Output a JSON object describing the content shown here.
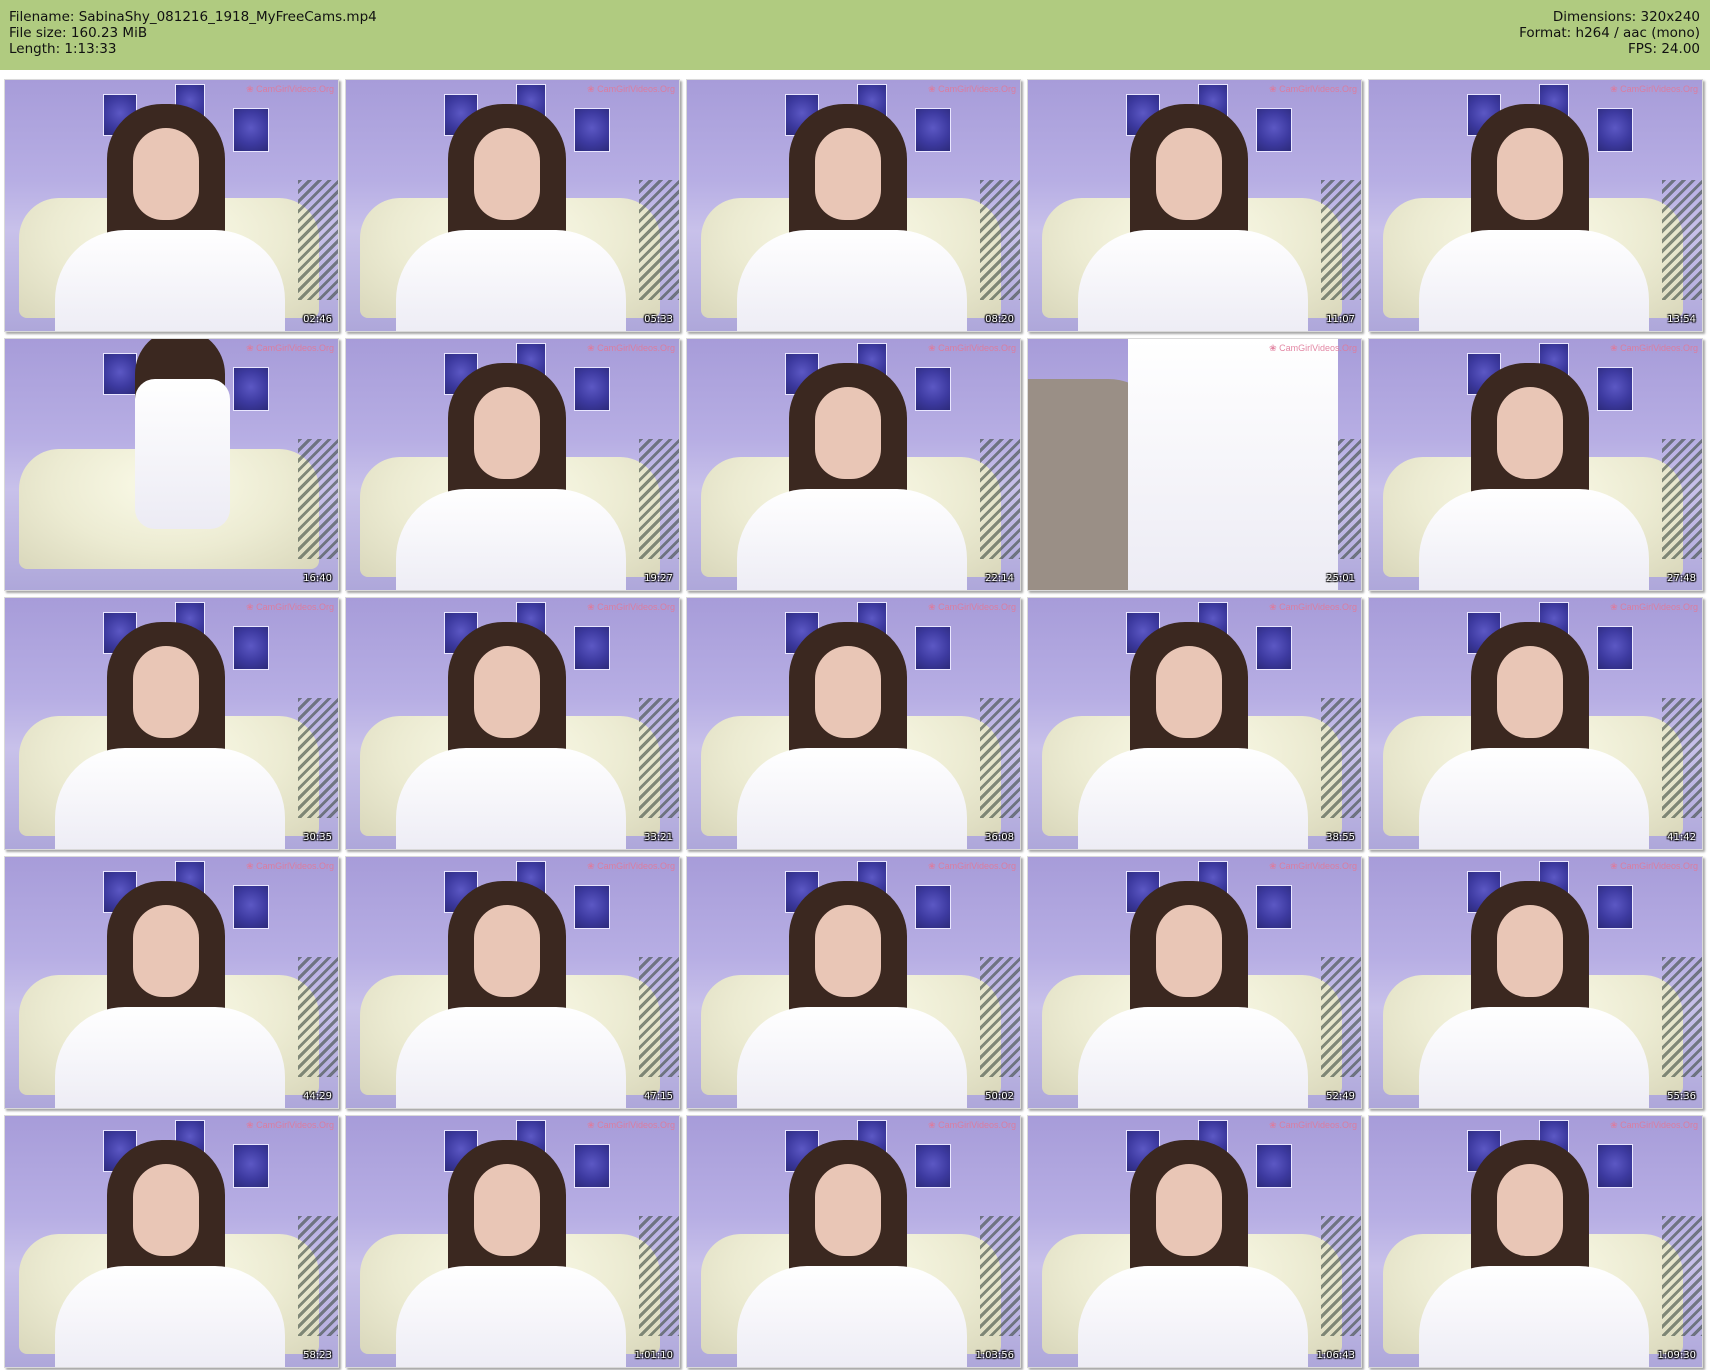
{
  "header": {
    "filename": "Filename: SabinaShy_081216_1918_MyFreeCams.mp4",
    "file_size": "File size: 160.23 MiB",
    "length": "Length: 1:13:33",
    "dimensions": "Dimensions: 320x240",
    "format": "Format: h264 / aac (mono)",
    "fps": "FPS: 24.00",
    "background_color": "#b0cb80"
  },
  "watermark": "CamGirlVideos.Org",
  "thumbnails": [
    {
      "time": "02:46"
    },
    {
      "time": "05:33"
    },
    {
      "time": "08:20"
    },
    {
      "time": "11:07"
    },
    {
      "time": "13:54"
    },
    {
      "time": "16:40"
    },
    {
      "time": "19:27"
    },
    {
      "time": "22:14"
    },
    {
      "time": "25:01"
    },
    {
      "time": "27:48"
    },
    {
      "time": "30:35"
    },
    {
      "time": "33:21"
    },
    {
      "time": "36:08"
    },
    {
      "time": "38:55"
    },
    {
      "time": "41:42"
    },
    {
      "time": "44:29"
    },
    {
      "time": "47:15"
    },
    {
      "time": "50:02"
    },
    {
      "time": "52:49"
    },
    {
      "time": "55:36"
    },
    {
      "time": "58:23"
    },
    {
      "time": "1:01:10"
    },
    {
      "time": "1:03:56"
    },
    {
      "time": "1:06:43"
    },
    {
      "time": "1:09:30"
    }
  ]
}
